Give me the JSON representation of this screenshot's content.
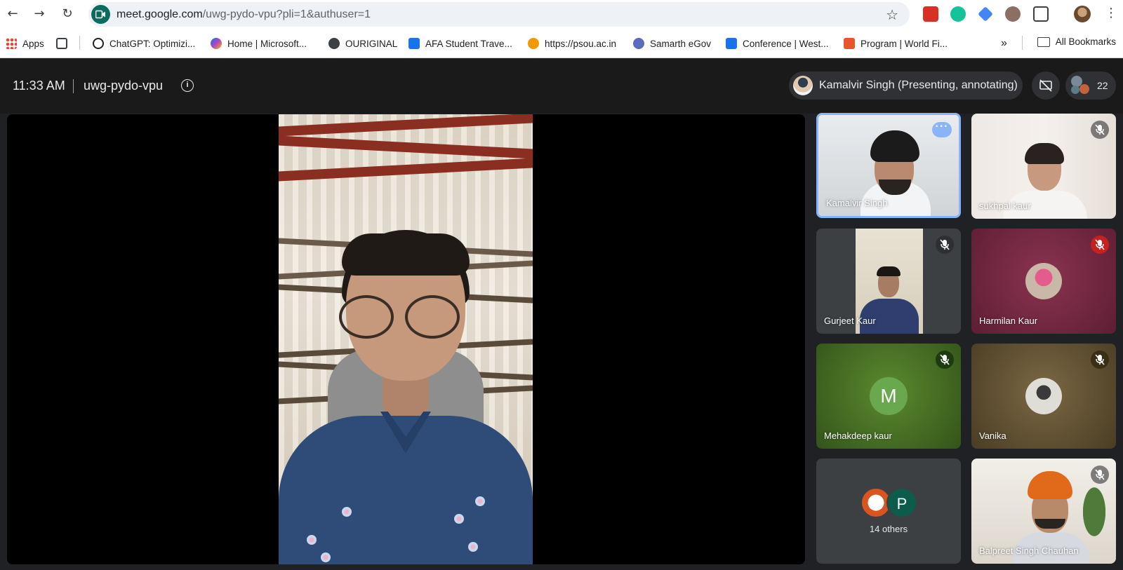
{
  "browser": {
    "url_host": "meet.google.com",
    "url_path": "/uwg-pydo-vpu?pli=1&authuser=1"
  },
  "bookmarks": [
    {
      "label": "Apps",
      "icon": "apps-grid-icon",
      "color": "#ea4335"
    },
    {
      "label": "ChatGPT: Optimizi...",
      "icon": "chatgpt-icon",
      "color": "#202124"
    },
    {
      "label": "Home | Microsoft...",
      "icon": "microsoft-copilot-icon",
      "color": "#7b61ff"
    },
    {
      "label": "OURIGINAL",
      "icon": "globe-icon",
      "color": "#3c4043"
    },
    {
      "label": "AFA Student Trave...",
      "icon": "s-favicon",
      "color": "#1a73e8"
    },
    {
      "label": "https://psou.ac.in",
      "icon": "psou-icon",
      "color": "#f29900"
    },
    {
      "label": "Samarth eGov",
      "icon": "samarth-icon",
      "color": "#5c6bc0"
    },
    {
      "label": "Conference | West...",
      "icon": "s-favicon",
      "color": "#1a73e8"
    },
    {
      "label": "Program | World Fi...",
      "icon": "world-icon",
      "color": "#e8542f"
    }
  ],
  "all_bookmarks_label": "All Bookmarks",
  "meet": {
    "time": "11:33 AM",
    "meeting_code": "uwg-pydo-vpu",
    "presenter_label": "Kamalvir Singh (Presenting, annotating)",
    "participant_count": "22"
  },
  "tiles": [
    {
      "name": "Kamalvir Singh",
      "active": true
    },
    {
      "name": "sukhpal kaur",
      "muted": true
    },
    {
      "name": "Gurjeet Kaur",
      "muted": true
    },
    {
      "name": "Harmilan Kaur",
      "muted": true
    },
    {
      "name": "Mehakdeep kaur",
      "muted": true,
      "avatar_letter": "M"
    },
    {
      "name": "Vanika",
      "muted": true
    },
    {
      "others_label": "14 others",
      "avatar_letter": "P"
    },
    {
      "name": "Balpreet Singh Chauhan",
      "muted": true
    }
  ],
  "colors": {
    "meet_bg": "#202124",
    "active_border": "#8ab4f8",
    "harmilan_bg": "#7a2a40",
    "mehakdeep_bg": "#4f7a2a",
    "vanika_bg": "#6b5a3a",
    "muted_red": "#c5221f"
  }
}
